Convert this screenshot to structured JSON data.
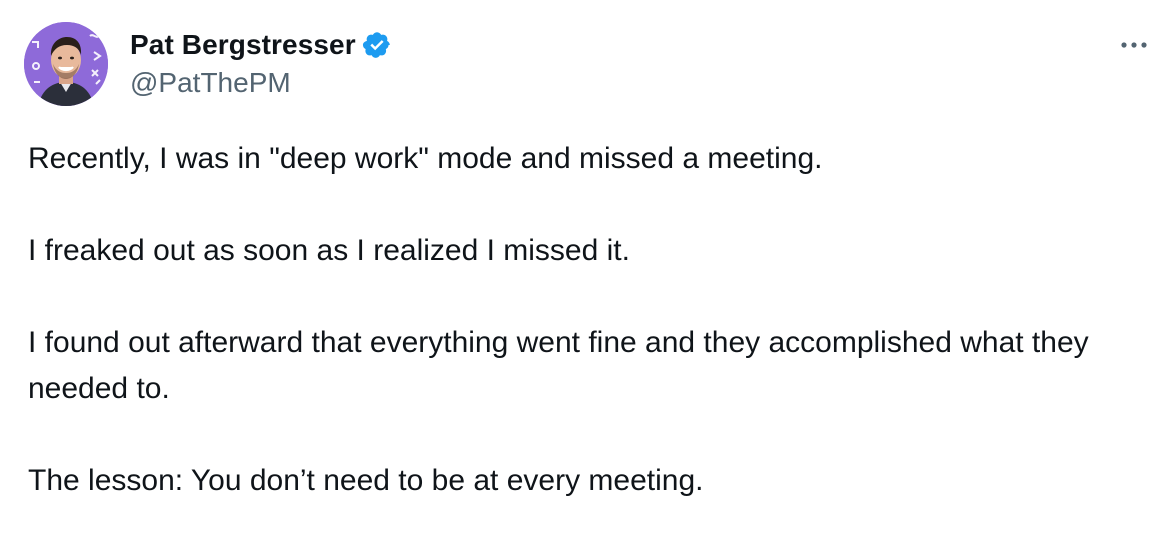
{
  "author": {
    "name": "Pat Bergstresser",
    "handle": "@PatThePM",
    "verified": true,
    "verified_color": "#1d9bf0"
  },
  "tweet": {
    "paragraphs": [
      "Recently, I was in \"deep work\" mode and missed a meeting.",
      "I freaked out as soon as I realized I missed it.",
      "I found out afterward that everything went fine and they accomplished what they needed to.",
      "The lesson: You don’t need to be at every meeting."
    ]
  },
  "icons": {
    "avatar": "avatar",
    "verified": "verified-badge-icon",
    "more": "more-options-icon"
  },
  "colors": {
    "text": "#0f1419",
    "secondary_text": "#536471",
    "avatar_background": "#8e6ad9"
  }
}
